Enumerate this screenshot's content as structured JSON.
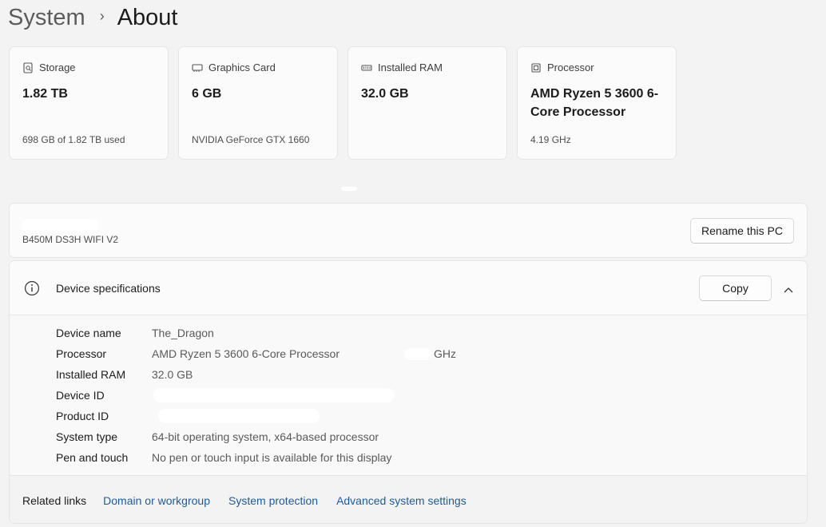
{
  "breadcrumb": {
    "parent": "System",
    "separator": "›",
    "current": "About"
  },
  "cards": [
    {
      "icon": "storage-icon",
      "label": "Storage",
      "value": "1.82 TB",
      "sub": "698 GB of 1.82 TB used"
    },
    {
      "icon": "graphics-card-icon",
      "label": "Graphics Card",
      "value": "6 GB",
      "sub": "NVIDIA GeForce GTX 1660"
    },
    {
      "icon": "ram-icon",
      "label": "Installed RAM",
      "value": "32.0 GB",
      "sub": ""
    },
    {
      "icon": "processor-icon",
      "label": "Processor",
      "value": "AMD Ryzen 5 3600 6-Core Processor",
      "sub": "4.19 GHz"
    }
  ],
  "pc": {
    "model": "B450M DS3H WIFI V2",
    "rename_label": "Rename this PC"
  },
  "specs": {
    "title": "Device specifications",
    "copy_label": "Copy",
    "rows": [
      {
        "key": "Device name",
        "value": "The_Dragon"
      },
      {
        "key": "Processor",
        "value": "AMD Ryzen 5 3600 6-Core Processor",
        "suffix": "GHz"
      },
      {
        "key": "Installed RAM",
        "value": "32.0 GB"
      },
      {
        "key": "Device ID",
        "value": ""
      },
      {
        "key": "Product ID",
        "value": ""
      },
      {
        "key": "System type",
        "value": "64-bit operating system, x64-based processor"
      },
      {
        "key": "Pen and touch",
        "value": "No pen or touch input is available for this display"
      }
    ]
  },
  "related": {
    "label": "Related links",
    "links": [
      "Domain or workgroup",
      "System protection",
      "Advanced system settings"
    ]
  },
  "colors": {
    "background": "#f3f3f3",
    "card": "#fbfbfb",
    "link": "#1f5b94"
  }
}
